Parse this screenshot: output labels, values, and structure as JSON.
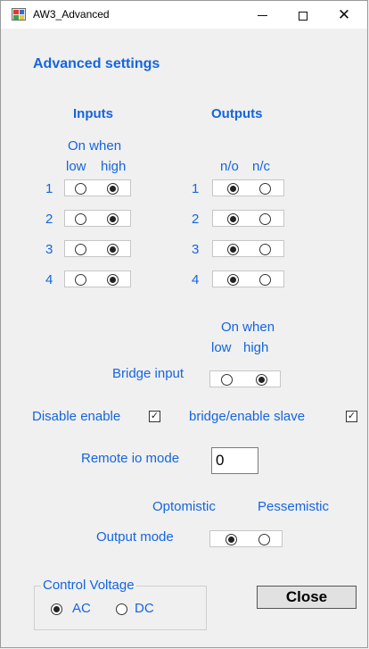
{
  "window": {
    "title": "AW3_Advanced",
    "minimize_glyph": "",
    "maximize_glyph": "",
    "close_glyph": "✕"
  },
  "heading": "Advanced settings",
  "inputs": {
    "header": "Inputs",
    "on_when": "On when",
    "col_low": "low",
    "col_high": "high",
    "rows": [
      {
        "num": "1",
        "selected": "high"
      },
      {
        "num": "2",
        "selected": "high"
      },
      {
        "num": "3",
        "selected": "high"
      },
      {
        "num": "4",
        "selected": "high"
      }
    ]
  },
  "outputs": {
    "header": "Outputs",
    "col_no": "n/o",
    "col_nc": "n/c",
    "rows": [
      {
        "num": "1",
        "selected": "n/o"
      },
      {
        "num": "2",
        "selected": "n/o"
      },
      {
        "num": "3",
        "selected": "n/o"
      },
      {
        "num": "4",
        "selected": "n/o"
      }
    ]
  },
  "bridge": {
    "on_when": "On when",
    "col_low": "low",
    "col_high": "high",
    "label": "Bridge input",
    "selected": "high"
  },
  "disable_enable": {
    "label": "Disable enable",
    "checked": true,
    "mark": "✓"
  },
  "bridge_enable_slave": {
    "label": "bridge/enable slave",
    "checked": true,
    "mark": "✓"
  },
  "remote_io": {
    "label": "Remote io mode",
    "value": "0"
  },
  "output_mode": {
    "col_opt": "Optomistic",
    "col_pes": "Pessemistic",
    "label": "Output mode",
    "selected": "Optomistic"
  },
  "control_voltage": {
    "legend": "Control Voltage",
    "ac_label": "AC",
    "dc_label": "DC",
    "selected": "AC"
  },
  "close_button": "Close",
  "colors": {
    "accent": "#1565e0",
    "background": "#f0f0f0"
  }
}
